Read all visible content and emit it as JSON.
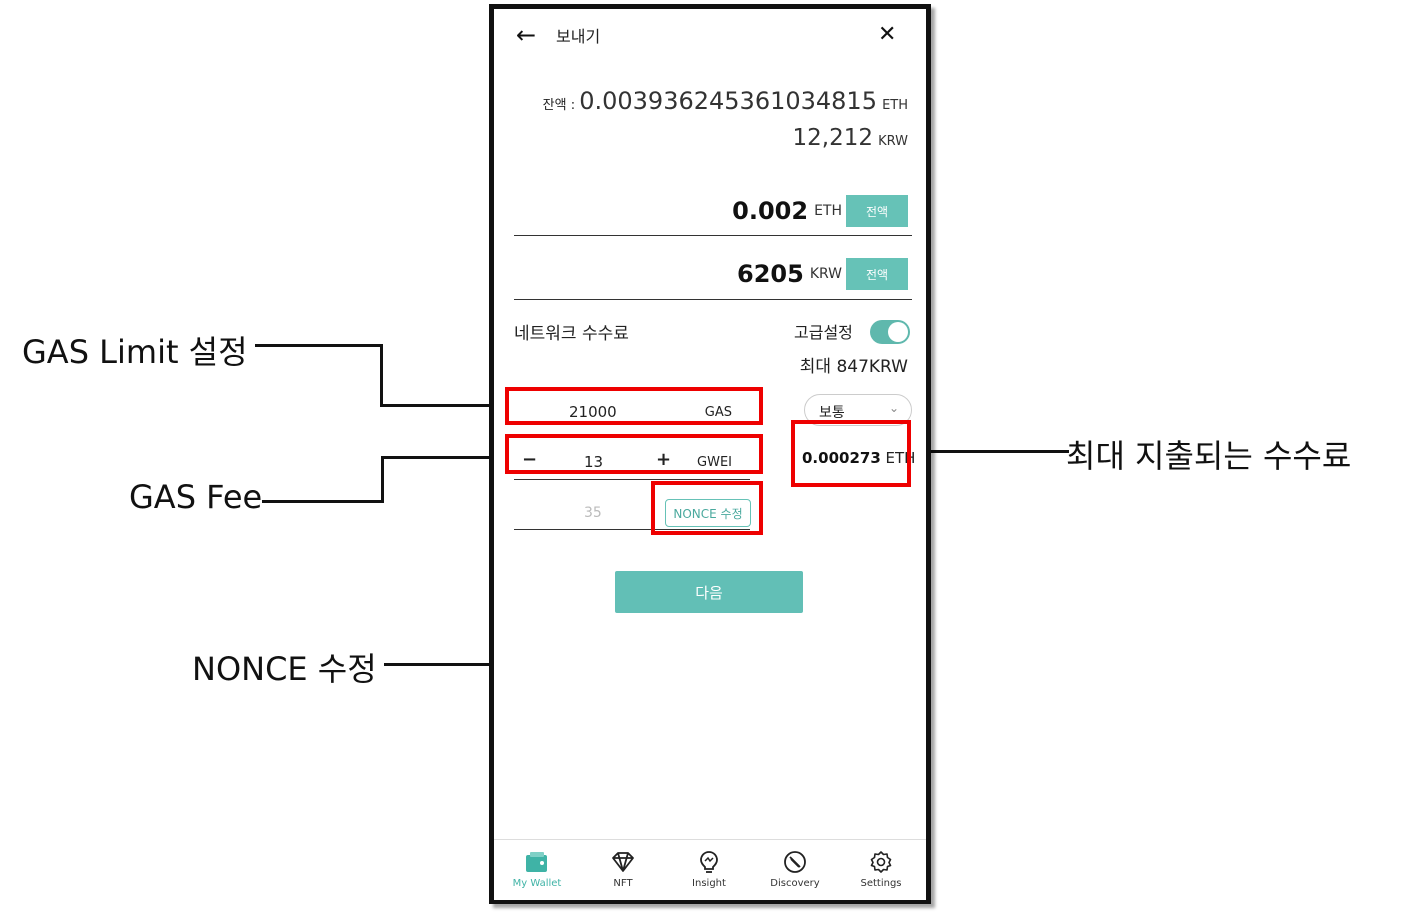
{
  "header": {
    "title": "보내기"
  },
  "balance": {
    "label": "잔액 : ",
    "eth_value": "0.003936245361034815",
    "eth_unit": "ETH",
    "krw_value": "12,212",
    "krw_unit": "KRW"
  },
  "amount": {
    "eth_value": "0.002",
    "eth_unit": "ETH",
    "krw_value": "6205",
    "krw_unit": "KRW",
    "all_button": "전액"
  },
  "fee": {
    "title": "네트워크 수수료",
    "advanced_label": "고급설정",
    "advanced_on": true,
    "max_label": "최대 847KRW",
    "gas_limit": "21000",
    "gas_unit": "GAS",
    "speed_select": "보통",
    "gas_price": "13",
    "gas_price_unit": "GWEI",
    "max_eth_value": "0.000273",
    "max_eth_unit": "ETH",
    "nonce_value": "35",
    "nonce_button": "NONCE 수정"
  },
  "next_button": "다음",
  "nav": [
    {
      "label": "My Wallet",
      "icon": "wallet-icon",
      "active": true
    },
    {
      "label": "NFT",
      "icon": "diamond-icon",
      "active": false
    },
    {
      "label": "Insight",
      "icon": "lightbulb-icon",
      "active": false
    },
    {
      "label": "Discovery",
      "icon": "compass-icon",
      "active": false
    },
    {
      "label": "Settings",
      "icon": "gear-icon",
      "active": false
    }
  ],
  "annotations": {
    "gas_limit": "GAS Limit 설정",
    "gas_fee": "GAS Fee",
    "nonce": "NONCE 수정",
    "max_fee": "최대 지출되는 수수료"
  },
  "colors": {
    "accent": "#66c2b7",
    "highlight_box": "#e00000"
  }
}
